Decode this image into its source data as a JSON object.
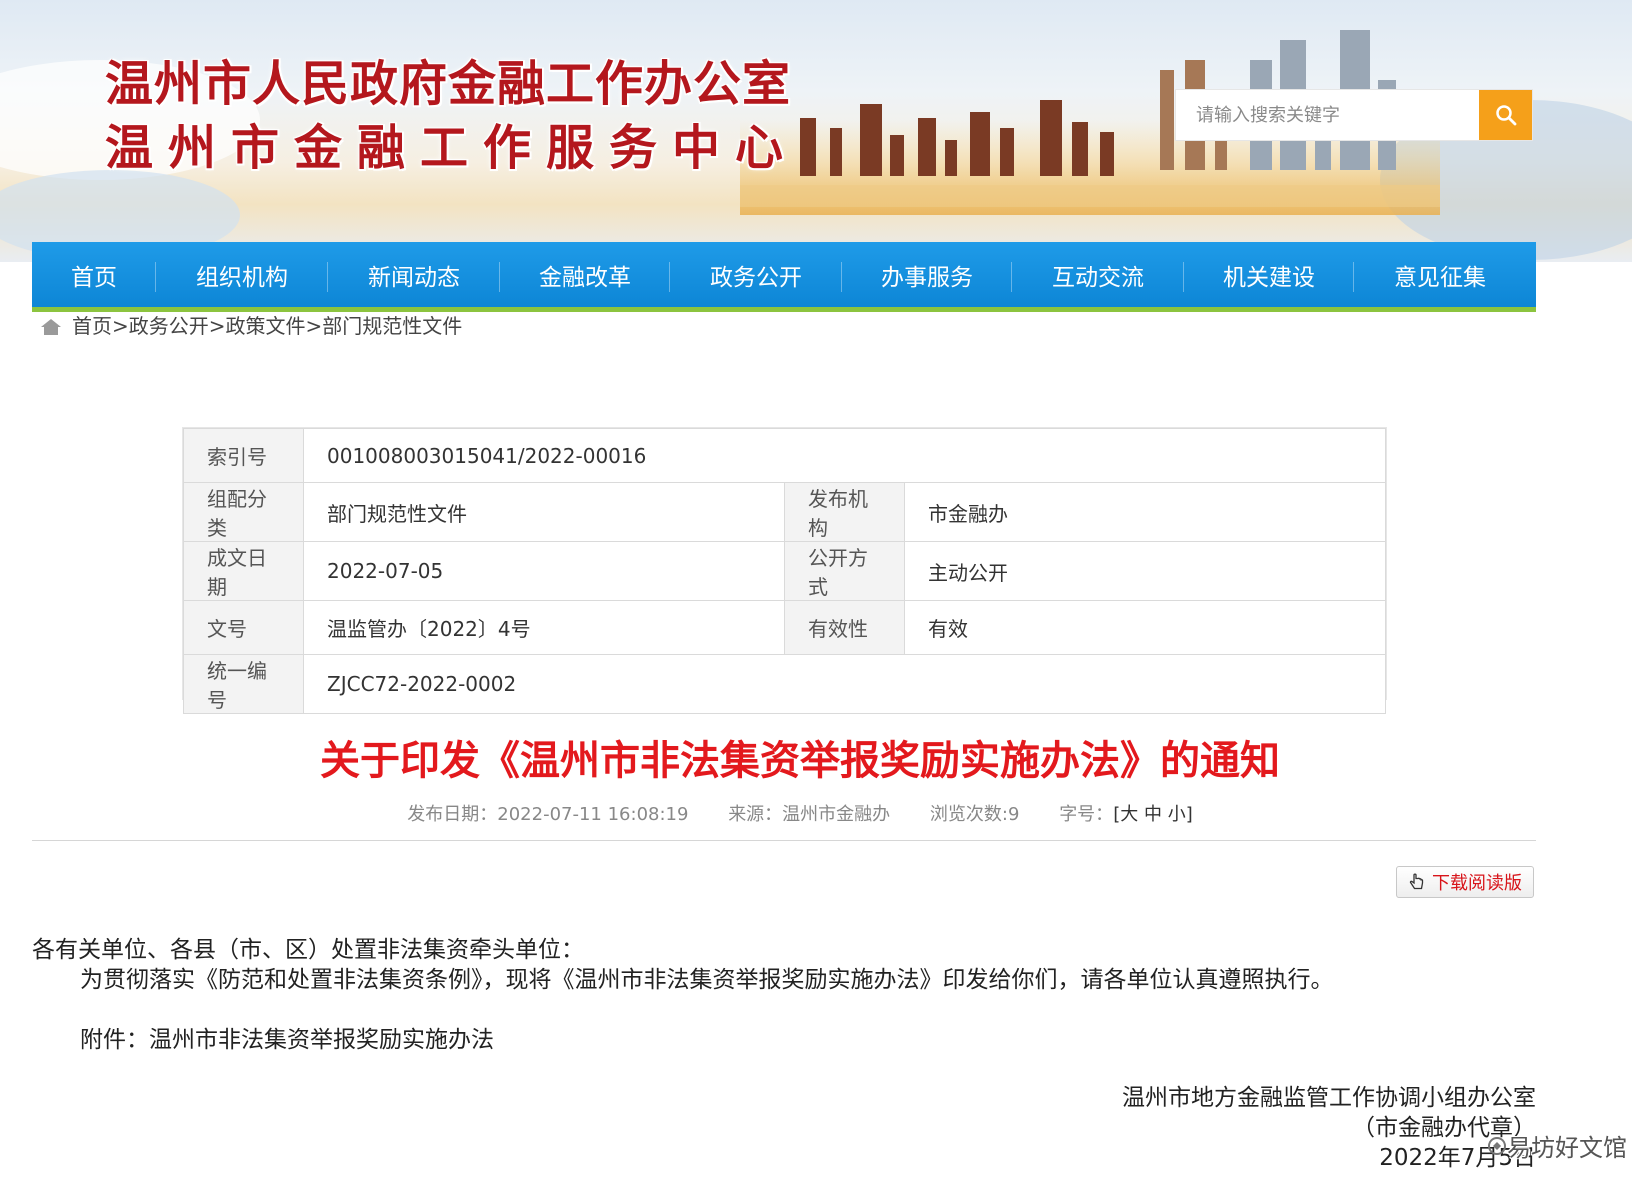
{
  "header": {
    "title_line1": "温州市人民政府金融工作办公室",
    "title_line2": "温州市金融工作服务中心",
    "search_placeholder": "请输入搜索关键字"
  },
  "nav": {
    "items": [
      "首页",
      "组织机构",
      "新闻动态",
      "金融改革",
      "政务公开",
      "办事服务",
      "互动交流",
      "机关建设",
      "意见征集"
    ]
  },
  "breadcrumb": {
    "items": [
      "首页>",
      "政务公开>",
      "政策文件>",
      "部门规范性文件"
    ]
  },
  "info": {
    "index_label": "索引号",
    "index_value": "001008003015041/2022-00016",
    "category_label": "组配分类",
    "category_value": "部门规范性文件",
    "publisher_label": "发布机构",
    "publisher_value": "市金融办",
    "date_label": "成文日期",
    "date_value": "2022-07-05",
    "open_label": "公开方式",
    "open_value": "主动公开",
    "docno_label": "文号",
    "docno_value": "温监管办〔2022〕4号",
    "valid_label": "有效性",
    "valid_value": "有效",
    "uniform_label": "统一编号",
    "uniform_value": "ZJCC72-2022-0002"
  },
  "article": {
    "title": "关于印发《温州市非法集资举报奖励实施办法》的通知",
    "publish_date": "发布日期：2022-07-11 16:08:19",
    "source": "来源：温州市金融办",
    "views": "浏览次数:9",
    "font_size_label": "字号：",
    "font_open": "[",
    "font_large": "大",
    "font_medium": "中",
    "font_small": "小",
    "font_close": "]",
    "download_label": "下载阅读版",
    "para1": "各有关单位、各县（市、区）处置非法集资牵头单位：",
    "para2": "为贯彻落实《防范和处置非法集资条例》，现将《温州市非法集资举报奖励实施办法》印发给你们，请各单位认真遵照执行。",
    "attachment": "附件：温州市非法集资举报奖励实施办法",
    "sign1": "温州市地方金融监管工作协调小组办公室",
    "sign2": "（市金融办代章）",
    "sign3": "2022年7月5日"
  },
  "watermark": "易坊好文馆",
  "colors": {
    "nav_blue": "#1f9be8",
    "nav_green_line": "#8cc43f",
    "title_red": "#e3191d",
    "search_orange": "#f5a01a"
  }
}
